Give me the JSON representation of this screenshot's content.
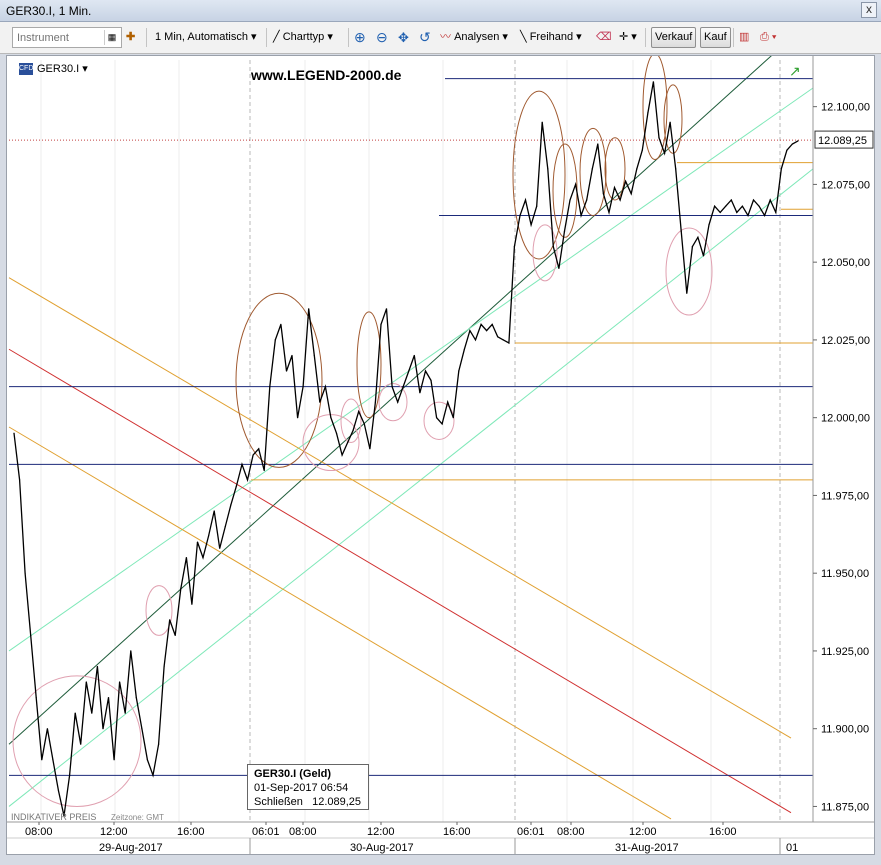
{
  "window": {
    "title": "GER30.I, 1 Min.",
    "close": "x"
  },
  "toolbar": {
    "instrument_placeholder": "Instrument",
    "interval": "1 Min,  Automatisch",
    "charttyp": "Charttyp",
    "analysen": "Analysen",
    "freihand": "Freihand",
    "verkauf": "Verkauf",
    "kauf": "Kauf"
  },
  "chart": {
    "symbol": "GER30.I",
    "watermark": "www.LEGEND-2000.de",
    "footer_left": "INDIKATIVER PREIS",
    "footer_tz": "Zeitzone: GMT",
    "price_tag": "12.089,25",
    "tooltip": {
      "title": "GER30.I (Geld)",
      "date": "01-Sep-2017 06:54",
      "close_label": "Schließen",
      "close_value": "12.089,25"
    },
    "colors": {
      "price": "#000000",
      "channel_dark": "#1e5c3a",
      "channel_light": "#7ee8b8",
      "orange": "#e0a030",
      "red": "#d03030",
      "navy": "#1b2a7a",
      "ellipse_brown": "#a05a30",
      "ellipse_pink": "#e0a0b0"
    }
  },
  "chart_data": {
    "type": "line",
    "title": "GER30.I, 1 Min.",
    "y_ticks": [
      "12.100,00",
      "12.075,00",
      "12.050,00",
      "12.025,00",
      "12.000,00",
      "11.975,00",
      "11.950,00",
      "11.925,00",
      "11.900,00",
      "11.875,00"
    ],
    "y_tick_values": [
      12100,
      12075,
      12050,
      12025,
      12000,
      11975,
      11950,
      11925,
      11900,
      11875
    ],
    "ylim": [
      11870,
      12115
    ],
    "x_time_labels": [
      "08:00",
      "12:00",
      "16:00",
      "06:01",
      "08:00",
      "12:00",
      "16:00",
      "06:01",
      "08:00",
      "12:00",
      "16:00"
    ],
    "x_date_labels": [
      "29-Aug-2017",
      "30-Aug-2017",
      "31-Aug-2017",
      "01"
    ],
    "last_close": 12089.25,
    "series": [
      {
        "values": [
          [
            0,
            11995
          ],
          [
            2,
            11980
          ],
          [
            4,
            11950
          ],
          [
            6,
            11930
          ],
          [
            8,
            11910
          ],
          [
            10,
            11890
          ],
          [
            12,
            11900
          ],
          [
            14,
            11890
          ],
          [
            16,
            11880
          ],
          [
            18,
            11872
          ],
          [
            20,
            11885
          ],
          [
            22,
            11905
          ],
          [
            24,
            11895
          ],
          [
            26,
            11915
          ],
          [
            28,
            11905
          ],
          [
            30,
            11920
          ],
          [
            32,
            11900
          ],
          [
            34,
            11910
          ],
          [
            36,
            11890
          ],
          [
            38,
            11915
          ],
          [
            40,
            11905
          ],
          [
            42,
            11925
          ],
          [
            44,
            11910
          ],
          [
            46,
            11900
          ],
          [
            48,
            11890
          ],
          [
            50,
            11885
          ],
          [
            52,
            11895
          ],
          [
            54,
            11920
          ],
          [
            56,
            11935
          ],
          [
            58,
            11930
          ],
          [
            60,
            11945
          ],
          [
            62,
            11955
          ],
          [
            64,
            11940
          ],
          [
            66,
            11960
          ],
          [
            68,
            11955
          ],
          [
            70,
            11962
          ],
          [
            72,
            11970
          ],
          [
            74,
            11958
          ],
          [
            76,
            11965
          ],
          [
            78,
            11972
          ],
          [
            80,
            11978
          ],
          [
            82,
            11985
          ],
          [
            84,
            11980
          ],
          [
            86,
            11988
          ],
          [
            88,
            11990
          ],
          [
            90,
            11983
          ],
          [
            92,
            12010
          ],
          [
            94,
            12025
          ],
          [
            96,
            12030
          ],
          [
            98,
            12015
          ],
          [
            100,
            12020
          ],
          [
            102,
            12000
          ],
          [
            104,
            12010
          ],
          [
            106,
            12035
          ],
          [
            108,
            12020
          ],
          [
            110,
            12005
          ],
          [
            112,
            12010
          ],
          [
            114,
            12000
          ],
          [
            116,
            11995
          ],
          [
            118,
            11988
          ],
          [
            120,
            11992
          ],
          [
            122,
            11996
          ],
          [
            124,
            12002
          ],
          [
            126,
            11998
          ],
          [
            128,
            11990
          ],
          [
            130,
            12005
          ],
          [
            132,
            12030
          ],
          [
            134,
            12035
          ],
          [
            136,
            12010
          ],
          [
            138,
            12005
          ],
          [
            140,
            12010
          ],
          [
            142,
            12015
          ],
          [
            144,
            12020
          ],
          [
            146,
            12008
          ],
          [
            148,
            12015
          ],
          [
            150,
            12012
          ],
          [
            152,
            12000
          ],
          [
            154,
            11998
          ],
          [
            156,
            12005
          ],
          [
            158,
            12000
          ],
          [
            160,
            12015
          ],
          [
            162,
            12022
          ],
          [
            164,
            12028
          ],
          [
            166,
            12025
          ],
          [
            168,
            12030
          ],
          [
            170,
            12028
          ],
          [
            172,
            12030
          ],
          [
            174,
            12026
          ],
          [
            176,
            12025
          ],
          [
            178,
            12024
          ],
          [
            180,
            12055
          ],
          [
            182,
            12065
          ],
          [
            184,
            12070
          ],
          [
            186,
            12062
          ],
          [
            188,
            12068
          ],
          [
            190,
            12095
          ],
          [
            192,
            12080
          ],
          [
            194,
            12055
          ],
          [
            196,
            12048
          ],
          [
            198,
            12060
          ],
          [
            200,
            12070
          ],
          [
            202,
            12075
          ],
          [
            204,
            12065
          ],
          [
            206,
            12070
          ],
          [
            208,
            12080
          ],
          [
            210,
            12088
          ],
          [
            212,
            12072
          ],
          [
            214,
            12066
          ],
          [
            216,
            12074
          ],
          [
            218,
            12070
          ],
          [
            220,
            12076
          ],
          [
            222,
            12072
          ],
          [
            224,
            12080
          ],
          [
            226,
            12086
          ],
          [
            228,
            12098
          ],
          [
            230,
            12108
          ],
          [
            232,
            12090
          ],
          [
            234,
            12085
          ],
          [
            236,
            12095
          ],
          [
            238,
            12080
          ],
          [
            240,
            12060
          ],
          [
            242,
            12040
          ],
          [
            244,
            12055
          ],
          [
            246,
            12058
          ],
          [
            248,
            12052
          ],
          [
            250,
            12062
          ],
          [
            252,
            12068
          ],
          [
            254,
            12066
          ],
          [
            256,
            12068
          ],
          [
            258,
            12070
          ],
          [
            260,
            12066
          ],
          [
            262,
            12068
          ],
          [
            264,
            12065
          ],
          [
            266,
            12070
          ],
          [
            268,
            12068
          ],
          [
            270,
            12065
          ],
          [
            272,
            12070
          ],
          [
            274,
            12066
          ],
          [
            276,
            12080
          ],
          [
            278,
            12086
          ],
          [
            280,
            12088
          ],
          [
            282,
            12089
          ]
        ]
      }
    ]
  }
}
